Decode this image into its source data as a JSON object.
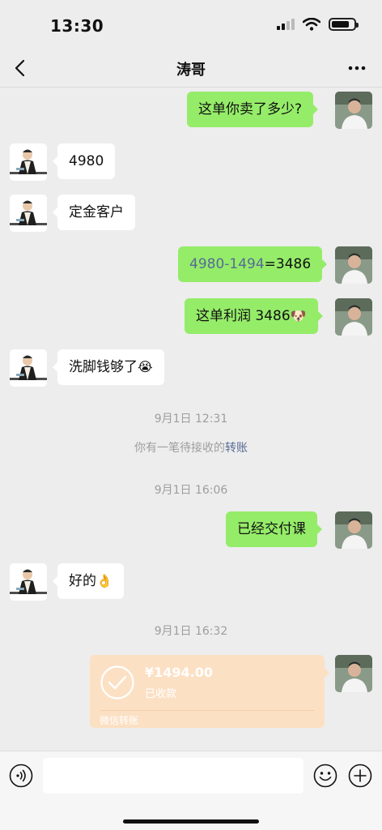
{
  "status_bar": {
    "time": "13:30"
  },
  "header": {
    "title": "涛哥"
  },
  "messages": [
    {
      "side": "right",
      "text": "这单你卖了多少?"
    },
    {
      "side": "left",
      "text": "4980"
    },
    {
      "side": "left",
      "text": "定金客户"
    },
    {
      "side": "right",
      "link_part": "4980-1494",
      "text_part": "=3486"
    },
    {
      "side": "right",
      "text": "这单利润 3486",
      "emoji": "🐶"
    },
    {
      "side": "left",
      "text": "洗脚钱够了",
      "emoji": "😭"
    },
    {
      "type": "time",
      "text": "9月1日 12:31"
    },
    {
      "type": "system",
      "text": "你有一笔待接收的",
      "link": "转账"
    },
    {
      "type": "time",
      "text": "9月1日 16:06"
    },
    {
      "side": "right",
      "text": "已经交付课"
    },
    {
      "side": "left",
      "text": "好的",
      "emoji": "👌"
    },
    {
      "type": "time",
      "text": "9月1日 16:32"
    },
    {
      "side": "right",
      "type": "transfer",
      "amount": "¥1494.00",
      "status": "已收款",
      "label": "微信转账"
    }
  ],
  "input": {
    "placeholder": ""
  },
  "colors": {
    "bubble_right": "#95ec69",
    "bubble_left": "#ffffff",
    "transfer_bg": "#fce0c4",
    "link": "#576b95",
    "background": "#ededed"
  },
  "icons": [
    "back-icon",
    "more-icon",
    "voice-icon",
    "emoji-icon",
    "plus-icon",
    "check-circle-icon"
  ]
}
